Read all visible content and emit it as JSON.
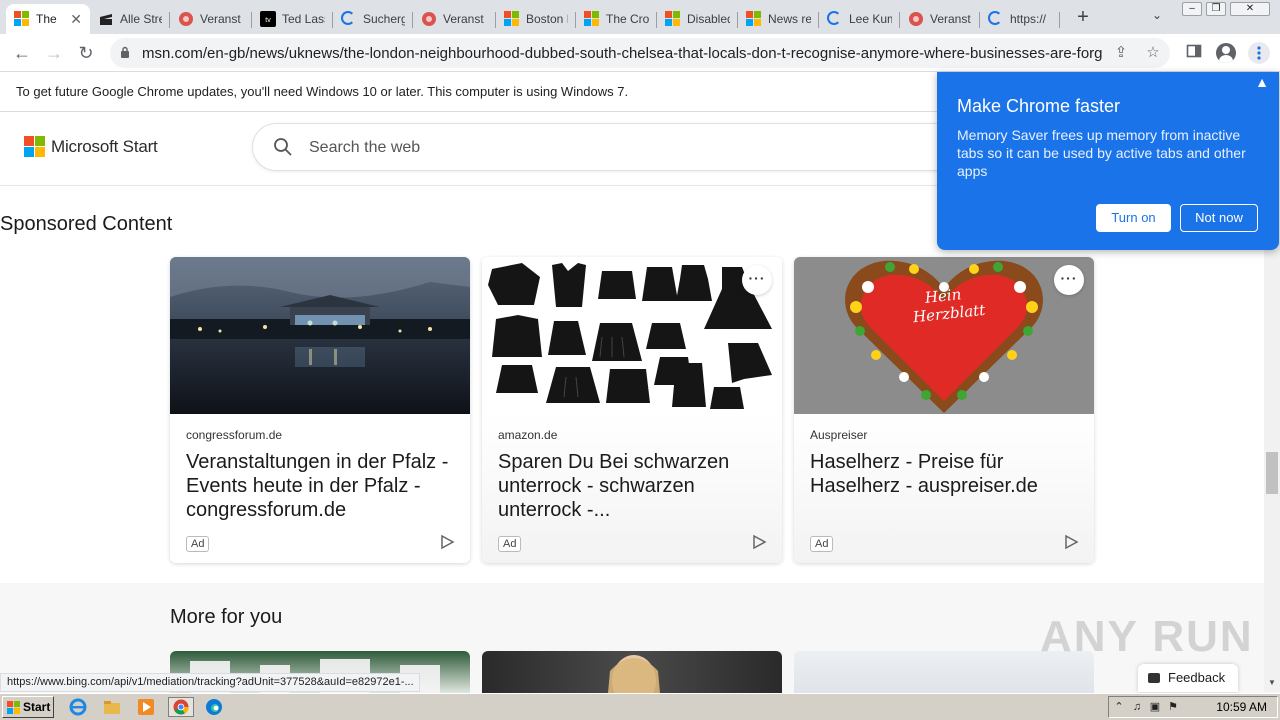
{
  "browser": {
    "tabs": [
      {
        "title": "The",
        "favicon": "microsoft-icon",
        "active": true
      },
      {
        "title": "Alle Stre",
        "favicon": "clapper-icon"
      },
      {
        "title": "Veranst",
        "favicon": "event-icon"
      },
      {
        "title": "Ted Lass",
        "favicon": "appletv-icon"
      },
      {
        "title": "Sucherg",
        "favicon": "loading-icon"
      },
      {
        "title": "Veranst",
        "favicon": "event-icon"
      },
      {
        "title": "Boston M",
        "favicon": "microsoft-icon"
      },
      {
        "title": "The Cro",
        "favicon": "microsoft-icon"
      },
      {
        "title": "Disabled",
        "favicon": "microsoft-icon"
      },
      {
        "title": "News rep",
        "favicon": "microsoft-icon"
      },
      {
        "title": "Lee Kum",
        "favicon": "loading-icon"
      },
      {
        "title": "Veranst",
        "favicon": "event-icon"
      },
      {
        "title": "https://",
        "favicon": "loading-icon"
      }
    ],
    "tab_close_glyph": "✕",
    "new_tab_glyph": "+",
    "tab_menu_glyph": "⌄",
    "url": "msn.com/en-gb/news/uknews/the-london-neighbourhood-dubbed-south-chelsea-that-locals-don-t-recognise-anymore-where-businesses-are-forgotten/ar-...",
    "update_notice": "To get future Google Chrome updates, you'll need Windows 10 or later. This computer is using Windows 7.",
    "status_url": "https://www.bing.com/api/v1/mediation/tracking?adUnit=377528&auId=e82972e1-..."
  },
  "msn": {
    "brand": "Microsoft Start",
    "search_placeholder": "Search the web",
    "sponsored_heading": "Sponsored Content",
    "cards": [
      {
        "source": "congressforum.de",
        "title": "Veranstaltungen in der Pfalz - Events heute in der Pfalz - congressforum.de",
        "ad_label": "Ad"
      },
      {
        "source": "amazon.de",
        "title": "Sparen Du Bei schwarzen unterrock - schwarzen unterrock -...",
        "ad_label": "Ad"
      },
      {
        "source": "Auspreiser",
        "title": "Haselherz - Preise für Haselherz - auspreiser.de",
        "ad_label": "Ad",
        "image_text": "Hein Herzblatt"
      }
    ],
    "more_heading": "More for you",
    "feedback_label": "Feedback"
  },
  "popup": {
    "title": "Make Chrome faster",
    "body": "Memory Saver frees up memory from inactive tabs so it can be used by active tabs and other apps",
    "turn_on": "Turn on",
    "not_now": "Not now"
  },
  "watermark": "ANY RUN",
  "taskbar": {
    "start_label": "Start",
    "clock": "10:59 AM"
  },
  "colors": {
    "chrome_blue": "#1a73e8",
    "ms_red": "#f25022",
    "ms_green": "#7fba00",
    "ms_blue": "#00a4ef",
    "ms_yellow": "#ffb900"
  }
}
